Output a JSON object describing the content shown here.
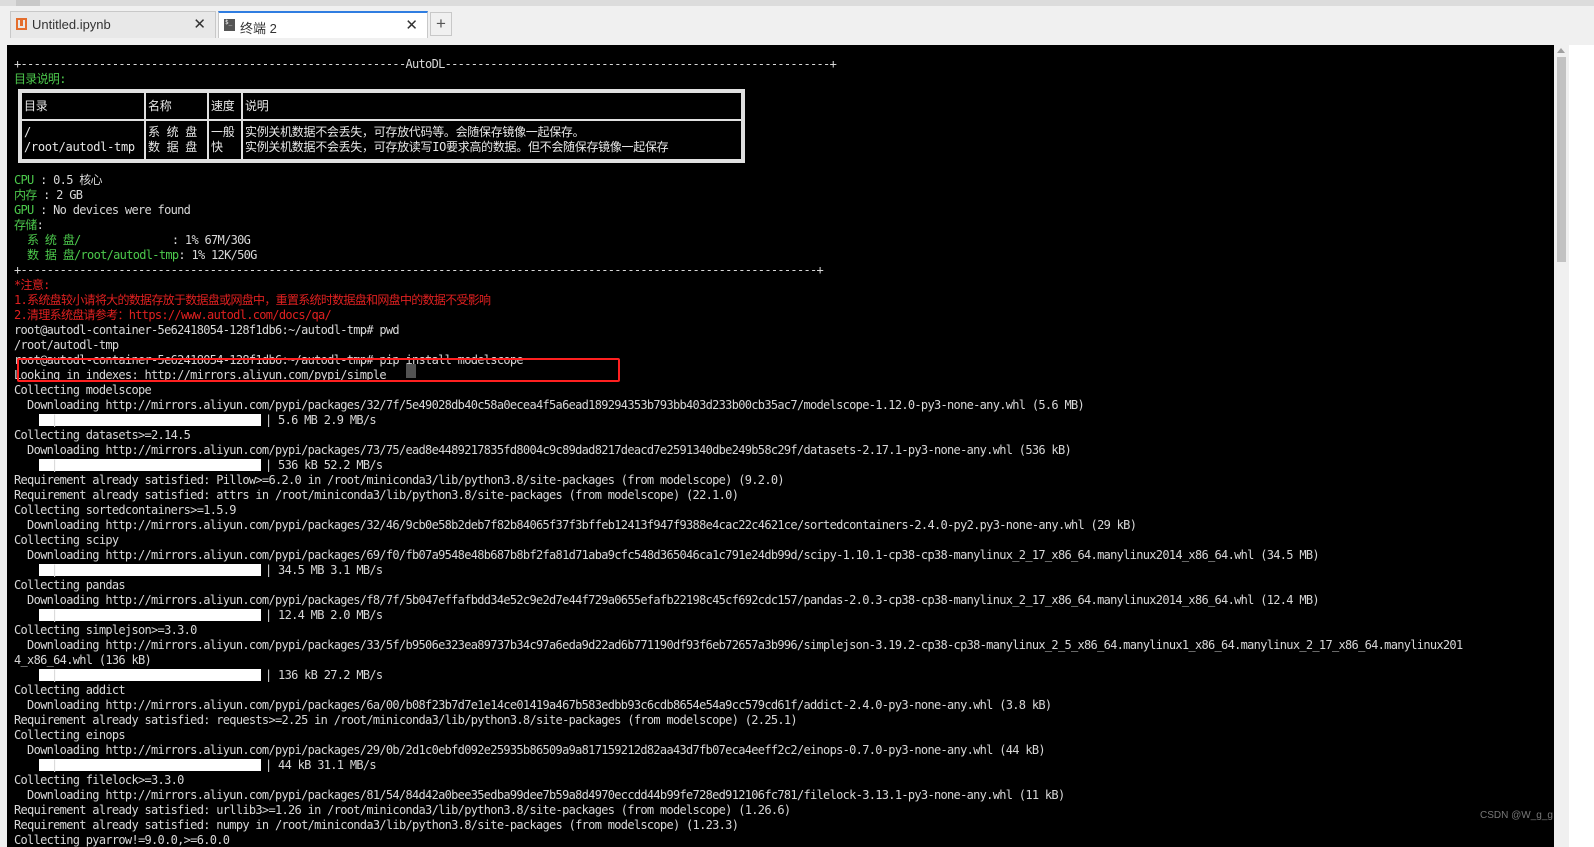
{
  "tabs": [
    {
      "label": "Untitled.ipynb",
      "icon": "notebook-icon"
    },
    {
      "label": "终端 2",
      "icon": "terminal-icon"
    }
  ],
  "new_tab_label": "+",
  "close_glyph": "✕",
  "terminal": {
    "autodl_border": "+-----------------------------------------------------------AutoDL-----------------------------------------------------------+",
    "dir_desc_label": "目录说明:",
    "table": {
      "headers": [
        "目录",
        "名称",
        "速度",
        "说明"
      ],
      "dir": "/\n/root/autodl-tmp",
      "name": "系 统 盘\n数 据 盘",
      "speed": "一般\n快",
      "desc": "实例关机数据不会丢失，可存放代码等。会随保存镜像一起保存。\n实例关机数据不会丢失，可存放读写IO要求高的数据。但不会随保存镜像一起保存"
    },
    "cpu_label": "CPU",
    "cpu_value": " : 0.5 核心",
    "mem_label": "内存",
    "mem_value": " : 2 GB",
    "gpu_label": "GPU",
    "gpu_value": " : No devices were found",
    "storage_label": "存储",
    "storage_colon": ":",
    "sys_disk_label": "  系 统 盘/              ",
    "sys_disk_value": ": 1% 67M/30G",
    "data_disk_label": "  数 据 盘/root/autodl-tmp",
    "data_disk_value": ": 1% 12K/50G",
    "bottom_border": "+--------------------------------------------------------------------------------------------------------------------------+",
    "notice_title": "*注意:",
    "notice_1": "1.系统盘较小请将大的数据存放于数据盘或网盘中，重置系统时数据盘和网盘中的数据不受影响",
    "notice_2": "2.清理系统盘请参考：https://www.autodl.com/docs/qa/",
    "prompt_1": "root@autodl-container-5e62418054-128f1db6:~/autodl-tmp# pwd",
    "pwd_output": "/root/autodl-tmp",
    "prompt_2": "root@autodl-container-5e62418054-128f1db6:~/autodl-tmp# pip install modelscope",
    "output": [
      {
        "text": "Looking in indexes: http://mirrors.aliyun.com/pypi/simple"
      },
      {
        "text": "Collecting modelscope"
      },
      {
        "text": "  Downloading http://mirrors.aliyun.com/pypi/packages/32/7f/5e49028db40c58a0ecea4f5a6ead189294353b793bb403d233b00cb35ac7/modelscope-1.12.0-py3-none-any.whl (5.6 MB)"
      },
      {
        "bar": true,
        "text": " 5.6 MB 2.9 MB/s"
      },
      {
        "text": "Collecting datasets>=2.14.5"
      },
      {
        "text": "  Downloading http://mirrors.aliyun.com/pypi/packages/73/75/ead8e4489217835fd8004c9c89dad8217deacd7e2591340dbe249b58c29f/datasets-2.17.1-py3-none-any.whl (536 kB)"
      },
      {
        "bar": true,
        "text": " 536 kB 52.2 MB/s"
      },
      {
        "text": "Requirement already satisfied: Pillow>=6.2.0 in /root/miniconda3/lib/python3.8/site-packages (from modelscope) (9.2.0)"
      },
      {
        "text": "Requirement already satisfied: attrs in /root/miniconda3/lib/python3.8/site-packages (from modelscope) (22.1.0)"
      },
      {
        "text": "Collecting sortedcontainers>=1.5.9"
      },
      {
        "text": "  Downloading http://mirrors.aliyun.com/pypi/packages/32/46/9cb0e58b2deb7f82b84065f37f3bffeb12413f947f9388e4cac22c4621ce/sortedcontainers-2.4.0-py2.py3-none-any.whl (29 kB)"
      },
      {
        "text": "Collecting scipy"
      },
      {
        "text": "  Downloading http://mirrors.aliyun.com/pypi/packages/69/f0/fb07a9548e48b687b8bf2fa81d71aba9cfc548d365046ca1c791e24db99d/scipy-1.10.1-cp38-cp38-manylinux_2_17_x86_64.manylinux2014_x86_64.whl (34.5 MB)"
      },
      {
        "bar": true,
        "text": " 34.5 MB 3.1 MB/s"
      },
      {
        "text": "Collecting pandas"
      },
      {
        "text": "  Downloading http://mirrors.aliyun.com/pypi/packages/f8/7f/5b047effafbdd34e52c9e2d7e44f729a0655efafb22198c45cf692cdc157/pandas-2.0.3-cp38-cp38-manylinux_2_17_x86_64.manylinux2014_x86_64.whl (12.4 MB)"
      },
      {
        "bar": true,
        "text": " 12.4 MB 2.0 MB/s"
      },
      {
        "text": "Collecting simplejson>=3.3.0"
      },
      {
        "text": "  Downloading http://mirrors.aliyun.com/pypi/packages/33/5f/b9506e323ea89737b34c97a6eda9d22ad6b771190df93f6eb72657a3b996/simplejson-3.19.2-cp38-cp38-manylinux_2_5_x86_64.manylinux1_x86_64.manylinux_2_17_x86_64.manylinux201"
      },
      {
        "text": "4_x86_64.whl (136 kB)"
      },
      {
        "bar": true,
        "text": " 136 kB 27.2 MB/s"
      },
      {
        "text": "Collecting addict"
      },
      {
        "text": "  Downloading http://mirrors.aliyun.com/pypi/packages/6a/00/b08f23b7d7e1e14ce01419a467b583edbb93c6cdb8654e54a9cc579cd61f/addict-2.4.0-py3-none-any.whl (3.8 kB)"
      },
      {
        "text": "Requirement already satisfied: requests>=2.25 in /root/miniconda3/lib/python3.8/site-packages (from modelscope) (2.25.1)"
      },
      {
        "text": "Collecting einops"
      },
      {
        "text": "  Downloading http://mirrors.aliyun.com/pypi/packages/29/0b/2d1c0ebfd092e25935b86509a9a817159212d82aa43d7fb07eca4eeff2c2/einops-0.7.0-py3-none-any.whl (44 kB)"
      },
      {
        "bar": true,
        "text": " 44 kB 31.1 MB/s"
      },
      {
        "text": "Collecting filelock>=3.3.0"
      },
      {
        "text": "  Downloading http://mirrors.aliyun.com/pypi/packages/81/54/84d42a0bee35edba99dee7b59a8d4970eccdd44b99fe728ed912106fc781/filelock-3.13.1-py3-none-any.whl (11 kB)"
      },
      {
        "text": "Requirement already satisfied: urllib3>=1.26 in /root/miniconda3/lib/python3.8/site-packages (from modelscope) (1.26.6)"
      },
      {
        "text": "Requirement already satisfied: numpy in /root/miniconda3/lib/python3.8/site-packages (from modelscope) (1.23.3)"
      },
      {
        "text": "Collecting pyarrow!=9.0.0,>=6.0.0"
      }
    ]
  },
  "watermark": "CSDN @W_g_g",
  "colors": {
    "terminal_bg": "#000000",
    "green": "#4cc94c",
    "red": "#e02020",
    "highlight": "#ff2020",
    "active_tab": "#2f7de1"
  }
}
